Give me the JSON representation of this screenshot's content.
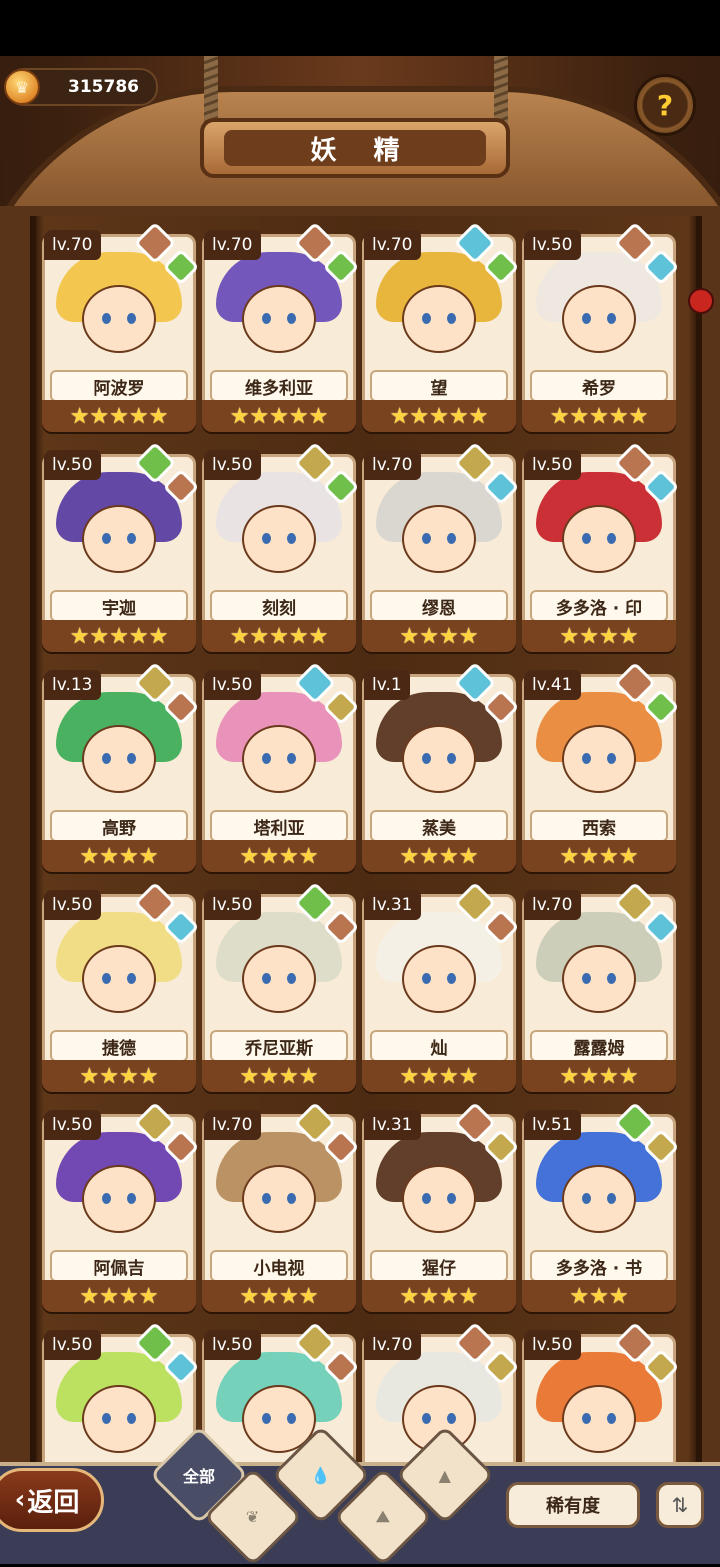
{
  "currency": {
    "value": "315786",
    "icon": "gold-coin-icon"
  },
  "header": {
    "title": "妖 精",
    "help_icon": "hint-bulb-icon"
  },
  "colors": {
    "fire": "#b87550",
    "earth": "#c3a84d",
    "water": "#5ec3d8",
    "wood": "#6fbf4a"
  },
  "cards": [
    {
      "level": "lv.70",
      "name": "阿波罗",
      "stars": "★★★★★",
      "hair": "#f2c548",
      "e1": "fire",
      "e2": "wood"
    },
    {
      "level": "lv.70",
      "name": "维多利亚",
      "stars": "★★★★★",
      "hair": "#6b4fb8",
      "e1": "fire",
      "e2": "wood"
    },
    {
      "level": "lv.70",
      "name": "望",
      "stars": "★★★★★",
      "hair": "#e8b335",
      "e1": "water",
      "e2": "wood"
    },
    {
      "level": "lv.50",
      "name": "希罗",
      "stars": "★★★★★",
      "hair": "#eee8e0",
      "e1": "fire",
      "e2": "water"
    },
    {
      "level": "lv.50",
      "name": "宇迦",
      "stars": "★★★★★",
      "hair": "#5b3fa3",
      "e1": "wood",
      "e2": "fire"
    },
    {
      "level": "lv.50",
      "name": "刻刻",
      "stars": "★★★★★",
      "hair": "#e8e4e4",
      "e1": "earth",
      "e2": "wood"
    },
    {
      "level": "lv.70",
      "name": "缪恩",
      "stars": "★★★★",
      "hair": "#d8d5d0",
      "e1": "earth",
      "e2": "water"
    },
    {
      "level": "lv.50",
      "name": "多多洛 · 印",
      "stars": "★★★★",
      "hair": "#c8262e",
      "e1": "fire",
      "e2": "water"
    },
    {
      "level": "lv.13",
      "name": "高野",
      "stars": "★★★★",
      "hair": "#3fae5a",
      "e1": "earth",
      "e2": "fire"
    },
    {
      "level": "lv.50",
      "name": "塔利亚",
      "stars": "★★★★",
      "hair": "#e88db8",
      "e1": "water",
      "e2": "earth"
    },
    {
      "level": "lv.1",
      "name": "蒸美",
      "stars": "★★★★",
      "hair": "#5a3622",
      "e1": "water",
      "e2": "fire"
    },
    {
      "level": "lv.41",
      "name": "西索",
      "stars": "★★★★",
      "hair": "#e8893a",
      "e1": "fire",
      "e2": "wood"
    },
    {
      "level": "lv.50",
      "name": "捷德",
      "stars": "★★★★",
      "hair": "#f0dc82",
      "e1": "fire",
      "e2": "water"
    },
    {
      "level": "lv.50",
      "name": "乔尼亚斯",
      "stars": "★★★★",
      "hair": "#dcdcc8",
      "e1": "wood",
      "e2": "fire"
    },
    {
      "level": "lv.31",
      "name": "灿",
      "stars": "★★★★",
      "hair": "#f4f0e6",
      "e1": "earth",
      "e2": "fire"
    },
    {
      "level": "lv.70",
      "name": "露露姆",
      "stars": "★★★★",
      "hair": "#c9ccb8",
      "e1": "earth",
      "e2": "water"
    },
    {
      "level": "lv.50",
      "name": "阿佩吉",
      "stars": "★★★★",
      "hair": "#6a3fb0",
      "e1": "earth",
      "e2": "fire"
    },
    {
      "level": "lv.70",
      "name": "小电视",
      "stars": "★★★★",
      "hair": "#b68d5e",
      "e1": "earth",
      "e2": "fire"
    },
    {
      "level": "lv.31",
      "name": "猩仔",
      "stars": "★★★★",
      "hair": "#5a3622",
      "e1": "fire",
      "e2": "earth"
    },
    {
      "level": "lv.51",
      "name": "多多洛 · 书",
      "stars": "★★★",
      "hair": "#3a6bd8",
      "e1": "wood",
      "e2": "earth"
    },
    {
      "level": "lv.50",
      "name": "",
      "stars": "",
      "hair": "#b8e05a",
      "e1": "wood",
      "e2": "water"
    },
    {
      "level": "lv.50",
      "name": "",
      "stars": "",
      "hair": "#6ed0b8",
      "e1": "earth",
      "e2": "fire"
    },
    {
      "level": "lv.70",
      "name": "",
      "stars": "",
      "hair": "#e8e8e0",
      "e1": "fire",
      "e2": "earth"
    },
    {
      "level": "lv.50",
      "name": "",
      "stars": "",
      "hair": "#e8742e",
      "e1": "fire",
      "e2": "earth"
    }
  ],
  "footer": {
    "back_label": "返回",
    "filter_all_label": "全部",
    "sort_label": "稀有度",
    "order_icon": "sort-order-icon"
  }
}
